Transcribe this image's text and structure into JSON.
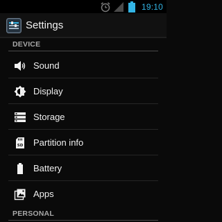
{
  "status_bar": {
    "time": "19:10",
    "accent": "#33b5e5"
  },
  "action_bar": {
    "title": "Settings",
    "icon": "settings-app-icon"
  },
  "sections": {
    "device": "DEVICE",
    "personal": "PERSONAL"
  },
  "device_items": [
    {
      "label": "Sound",
      "icon": "speaker-icon"
    },
    {
      "label": "Display",
      "icon": "brightness-icon"
    },
    {
      "label": "Storage",
      "icon": "storage-icon"
    },
    {
      "label": "Partition info",
      "icon": "sd-card-icon"
    },
    {
      "label": "Battery",
      "icon": "battery-icon"
    },
    {
      "label": "Apps",
      "icon": "apps-icon"
    }
  ]
}
